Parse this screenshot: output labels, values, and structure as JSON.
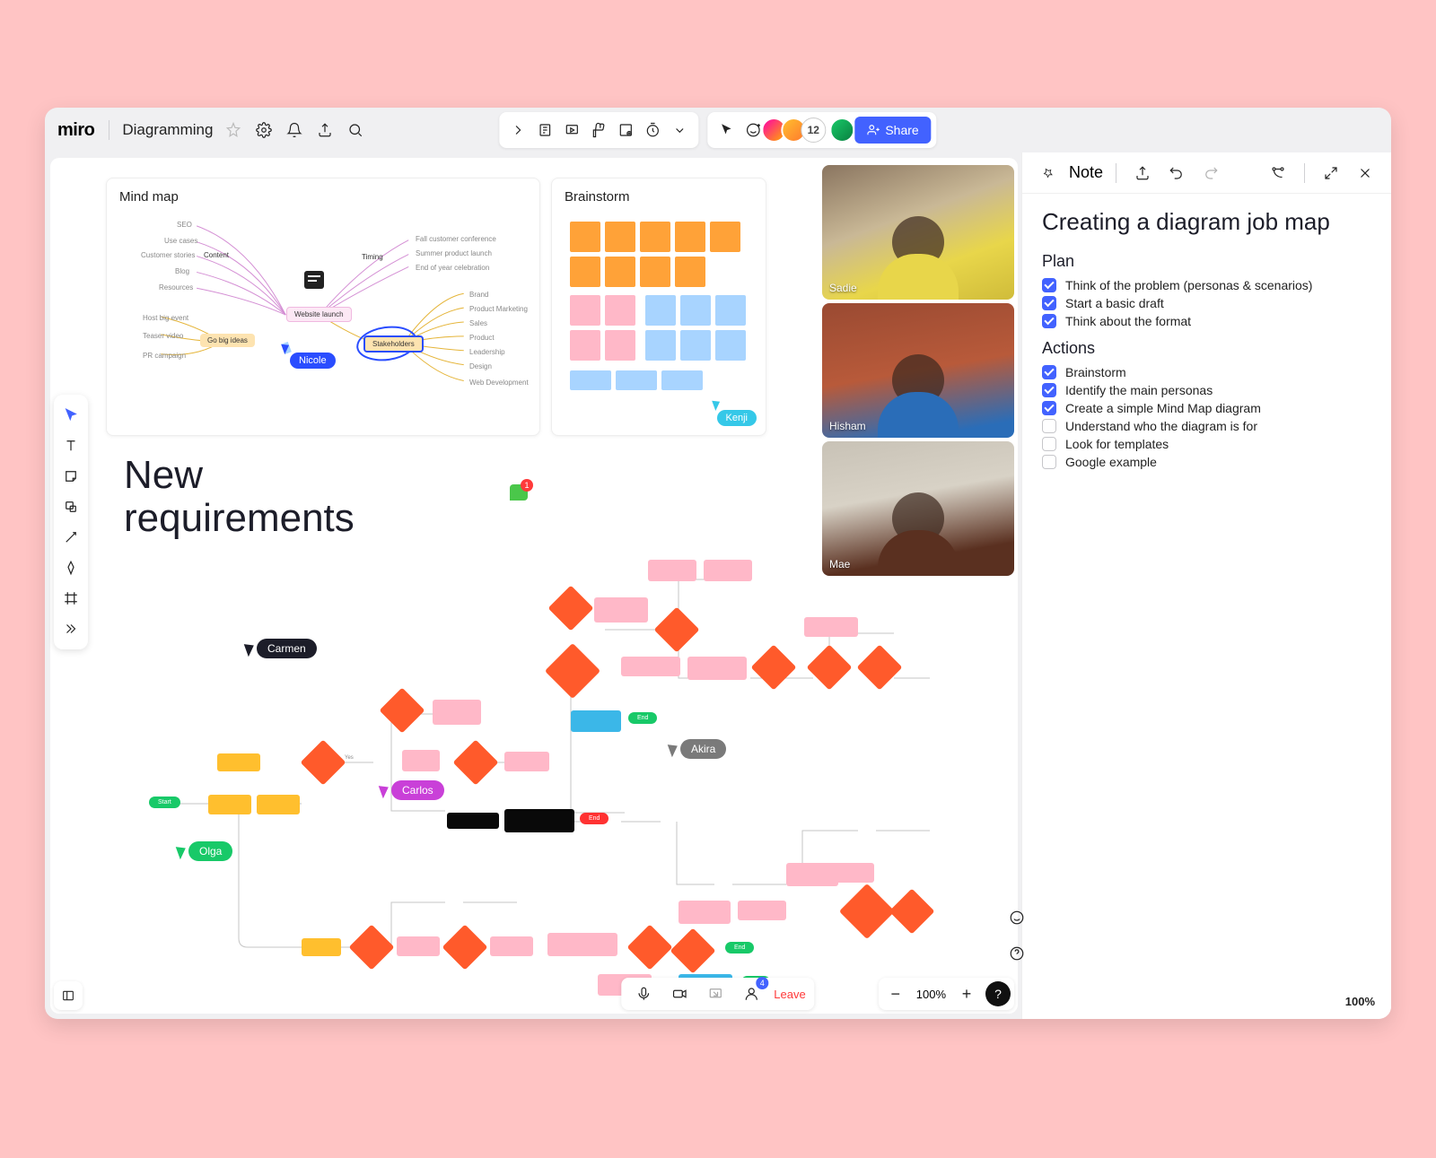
{
  "app": {
    "logo": "miro",
    "board_title": "Diagramming"
  },
  "top_toolbar": {
    "share_label": "Share",
    "avatar_count": "12"
  },
  "frames": {
    "mindmap": {
      "title": "Mind map",
      "center": "Website launch",
      "hub_right": "Stakeholders",
      "hub_left": "Go big ideas",
      "left_nodes": [
        "SEO",
        "Use cases",
        "Customer stories",
        "Content",
        "Blog",
        "Resources",
        "Host big event",
        "Teaser video",
        "PR campaign"
      ],
      "right_top": [
        "Timing",
        "Fall customer conference",
        "Summer product launch",
        "End of year celebration"
      ],
      "right_bottom": [
        "Brand",
        "Product Marketing",
        "Sales",
        "Product",
        "Leadership",
        "Design",
        "Web Development"
      ]
    },
    "brainstorm": {
      "title": "Brainstorm"
    }
  },
  "cursors": {
    "nicole": "Nicole",
    "kenji": "Kenji",
    "carmen": "Carmen",
    "carlos": "Carlos",
    "akira": "Akira",
    "olga": "Olga"
  },
  "flowchart": {
    "title": "New\nrequirements"
  },
  "video": {
    "p1": "Sadie",
    "p2": "Hisham",
    "p3": "Mae"
  },
  "bottom": {
    "leave": "Leave",
    "zoom": "100%",
    "presence_count": "4"
  },
  "note": {
    "header": "Note",
    "title": "Creating a diagram job map",
    "section_plan": "Plan",
    "plan_items": [
      {
        "label": "Think of the problem (personas & scenarios)",
        "checked": true
      },
      {
        "label": "Start a basic draft",
        "checked": true
      },
      {
        "label": "Think about the format",
        "checked": true
      }
    ],
    "section_actions": "Actions",
    "action_items": [
      {
        "label": "Brainstorm",
        "checked": true
      },
      {
        "label": "Identify the main personas",
        "checked": true
      },
      {
        "label": "Create a simple Mind Map diagram",
        "checked": true
      },
      {
        "label": "Understand who the diagram is for",
        "checked": false
      },
      {
        "label": "Look for templates",
        "checked": false
      },
      {
        "label": "Google example",
        "checked": false
      }
    ],
    "panel_zoom": "100%"
  }
}
